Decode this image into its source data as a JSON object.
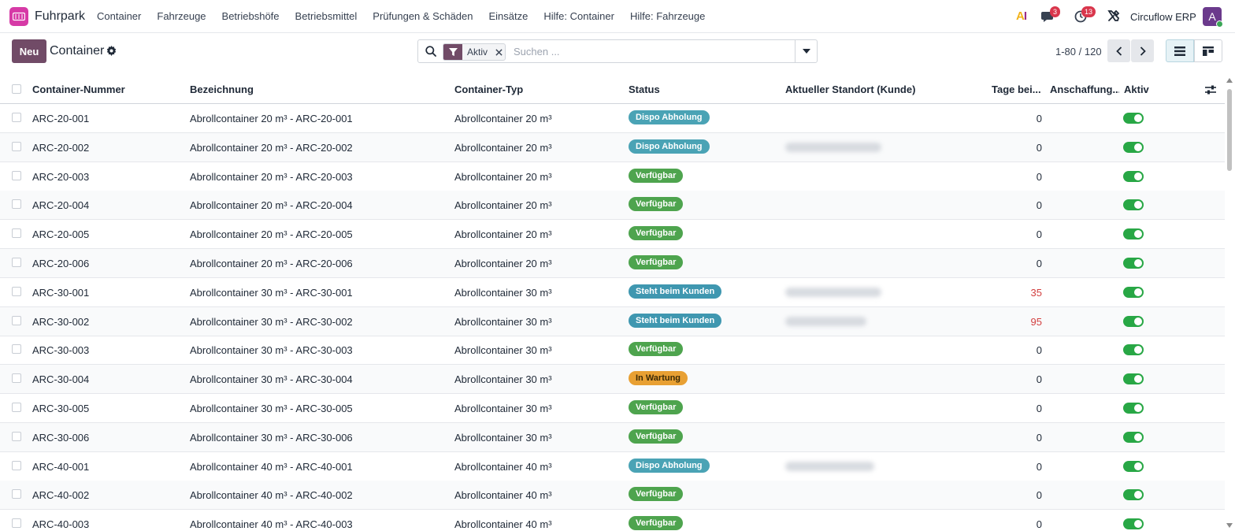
{
  "app": {
    "name": "Fuhrpark",
    "company": "Circuflow ERP",
    "avatar_initial": "A",
    "messages_badge": "3",
    "activities_badge": "13",
    "ai_label": "AI"
  },
  "menu": [
    "Container",
    "Fahrzeuge",
    "Betriebshöfe",
    "Betriebsmittel",
    "Prüfungen & Schäden",
    "Einsätze",
    "Hilfe: Container",
    "Hilfe: Fahrzeuge"
  ],
  "control": {
    "new_label": "Neu",
    "title": "Container",
    "filter_facet": "Aktiv",
    "search_placeholder": "Suchen ...",
    "pager": "1-80 / 120"
  },
  "table": {
    "columns": [
      "Container-Nummer",
      "Bezeichnung",
      "Container-Typ",
      "Status",
      "Aktueller Standort (Kunde)",
      "Tage bei...",
      "Anschaffung...",
      "Aktiv"
    ],
    "rows": [
      {
        "number": "ARC-20-001",
        "name": "Abrollcontainer 20 m³ - ARC-20-001",
        "type": "Abrollcontainer 20 m³",
        "status": "Dispo Abholung",
        "status_kind": "dispo",
        "location": "",
        "days": "0",
        "days_late": false,
        "active": true
      },
      {
        "number": "ARC-20-002",
        "name": "Abrollcontainer 20 m³ - ARC-20-002",
        "type": "Abrollcontainer 20 m³",
        "status": "Dispo Abholung",
        "status_kind": "dispo",
        "location": "blurred",
        "days": "0",
        "days_late": false,
        "active": true
      },
      {
        "number": "ARC-20-003",
        "name": "Abrollcontainer 20 m³ - ARC-20-003",
        "type": "Abrollcontainer 20 m³",
        "status": "Verfügbar",
        "status_kind": "available",
        "location": "",
        "days": "0",
        "days_late": false,
        "active": true
      },
      {
        "number": "ARC-20-004",
        "name": "Abrollcontainer 20 m³ - ARC-20-004",
        "type": "Abrollcontainer 20 m³",
        "status": "Verfügbar",
        "status_kind": "available",
        "location": "",
        "days": "0",
        "days_late": false,
        "active": true
      },
      {
        "number": "ARC-20-005",
        "name": "Abrollcontainer 20 m³ - ARC-20-005",
        "type": "Abrollcontainer 20 m³",
        "status": "Verfügbar",
        "status_kind": "available",
        "location": "",
        "days": "0",
        "days_late": false,
        "active": true
      },
      {
        "number": "ARC-20-006",
        "name": "Abrollcontainer 20 m³ - ARC-20-006",
        "type": "Abrollcontainer 20 m³",
        "status": "Verfügbar",
        "status_kind": "available",
        "location": "",
        "days": "0",
        "days_late": false,
        "active": true
      },
      {
        "number": "ARC-30-001",
        "name": "Abrollcontainer 30 m³ - ARC-30-001",
        "type": "Abrollcontainer 30 m³",
        "status": "Steht beim Kunden",
        "status_kind": "customer",
        "location": "blurred",
        "days": "35",
        "days_late": true,
        "active": true
      },
      {
        "number": "ARC-30-002",
        "name": "Abrollcontainer 30 m³ - ARC-30-002",
        "type": "Abrollcontainer 30 m³",
        "status": "Steht beim Kunden",
        "status_kind": "customer",
        "location": "blurred",
        "days": "95",
        "days_late": true,
        "active": true
      },
      {
        "number": "ARC-30-003",
        "name": "Abrollcontainer 30 m³ - ARC-30-003",
        "type": "Abrollcontainer 30 m³",
        "status": "Verfügbar",
        "status_kind": "available",
        "location": "",
        "days": "0",
        "days_late": false,
        "active": true
      },
      {
        "number": "ARC-30-004",
        "name": "Abrollcontainer 30 m³ - ARC-30-004",
        "type": "Abrollcontainer 30 m³",
        "status": "In Wartung",
        "status_kind": "maintenance",
        "location": "",
        "days": "0",
        "days_late": false,
        "active": true
      },
      {
        "number": "ARC-30-005",
        "name": "Abrollcontainer 30 m³ - ARC-30-005",
        "type": "Abrollcontainer 30 m³",
        "status": "Verfügbar",
        "status_kind": "available",
        "location": "",
        "days": "0",
        "days_late": false,
        "active": true
      },
      {
        "number": "ARC-30-006",
        "name": "Abrollcontainer 30 m³ - ARC-30-006",
        "type": "Abrollcontainer 30 m³",
        "status": "Verfügbar",
        "status_kind": "available",
        "location": "",
        "days": "0",
        "days_late": false,
        "active": true
      },
      {
        "number": "ARC-40-001",
        "name": "Abrollcontainer 40 m³ - ARC-40-001",
        "type": "Abrollcontainer 40 m³",
        "status": "Dispo Abholung",
        "status_kind": "dispo",
        "location": "blurred",
        "days": "0",
        "days_late": false,
        "active": true
      },
      {
        "number": "ARC-40-002",
        "name": "Abrollcontainer 40 m³ - ARC-40-002",
        "type": "Abrollcontainer 40 m³",
        "status": "Verfügbar",
        "status_kind": "available",
        "location": "",
        "days": "0",
        "days_late": false,
        "active": true
      },
      {
        "number": "ARC-40-003",
        "name": "Abrollcontainer 40 m³ - ARC-40-003",
        "type": "Abrollcontainer 40 m³",
        "status": "Verfügbar",
        "status_kind": "available",
        "location": "",
        "days": "0",
        "days_late": false,
        "active": true
      }
    ]
  },
  "colors": {
    "brand": "#714b67",
    "app_icon": "#d63aa6",
    "status_dispo": "#4aa3b5",
    "status_available": "#4ea44e",
    "status_customer": "#3f97b0",
    "status_maintenance": "#e8a033",
    "toggle_on": "#28a745",
    "days_late": "#d23f3f"
  },
  "icons": [
    "app-logo-icon",
    "ai-icon",
    "chat-icon",
    "clock-icon",
    "tools-icon",
    "gear-icon",
    "search-icon",
    "filter-icon",
    "close-icon",
    "chevron-down-icon",
    "chevron-left-icon",
    "chevron-right-icon",
    "list-view-icon",
    "kanban-view-icon",
    "optional-columns-icon"
  ]
}
